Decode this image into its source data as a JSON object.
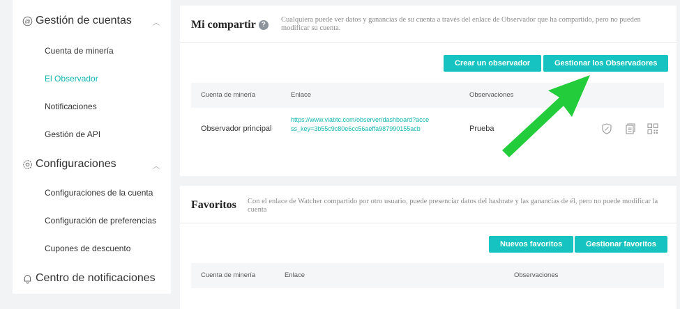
{
  "sidebar": {
    "groups": [
      {
        "label": "Gestión de cuentas",
        "items": [
          "Cuenta de minería",
          "El Observador",
          "Notificaciones",
          "Gestión de API"
        ],
        "active": "El Observador"
      },
      {
        "label": "Configuraciones",
        "items": [
          "Configuraciones de la cuenta",
          "Configuración de preferencias",
          "Cupones de descuento"
        ]
      },
      {
        "label": "Centro de notificaciones",
        "items": []
      }
    ]
  },
  "share": {
    "title": "Mi compartir",
    "help_icon": "?",
    "description": "Cualquiera puede ver datos y ganancias de su cuenta a través del enlace de Observador que ha compartido, pero no pueden modificar su cuenta.",
    "buttons": [
      "Crear un observador",
      "Gestionar los Observadores"
    ],
    "columns": [
      "Cuenta de minería",
      "Enlace",
      "Observaciones"
    ],
    "rows": [
      {
        "account": "Observador principal",
        "link": "https://www.viabtc.com/observer/dashboard?access_key=3b55c9c80e6cc56aeffa987990155acb",
        "note": "Prueba"
      }
    ]
  },
  "favorites": {
    "title": "Favoritos",
    "description": "Con el enlace de Watcher compartido por otro usuario, puede presenciar datos del hashrate y las ganancias de él, pero no puede modificar la cuenta",
    "buttons": [
      "Nuevos favoritos",
      "Gestionar favoritos"
    ],
    "columns": [
      "Cuenta de minería",
      "Enlace",
      "Observaciones"
    ]
  },
  "colors": {
    "accent": "#17c3c0",
    "arrow": "#22cc3a"
  },
  "icons": [
    "account-icon",
    "gear-icon",
    "bell-icon",
    "chevron-up-icon",
    "edit-icon",
    "copy-icon",
    "qr-code-icon"
  ]
}
